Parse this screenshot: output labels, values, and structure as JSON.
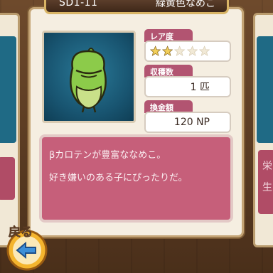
{
  "header": {
    "code": "SD1-11",
    "name": "緑黄色なめこ"
  },
  "stats": {
    "rarity_label": "レア度",
    "rarity_value": 2,
    "rarity_max": 5,
    "harvest_label": "収穫数",
    "harvest_value": "1 匹",
    "price_label": "換金額",
    "price_value": "120 NP"
  },
  "description": {
    "line1": "βカロテンが豊富ななめこ。",
    "line2": "好き嫌いのある子にぴったりだ。"
  },
  "back_button": {
    "label": "戻る"
  },
  "side_right": {
    "text1": "栄",
    "text2": "生"
  },
  "colors": {
    "accent": "#b25471",
    "desc_bg": "#c65f7a",
    "portrait_bg": "#185470",
    "star_on": "#f2cf5a",
    "star_off": "#f1e9d6"
  }
}
